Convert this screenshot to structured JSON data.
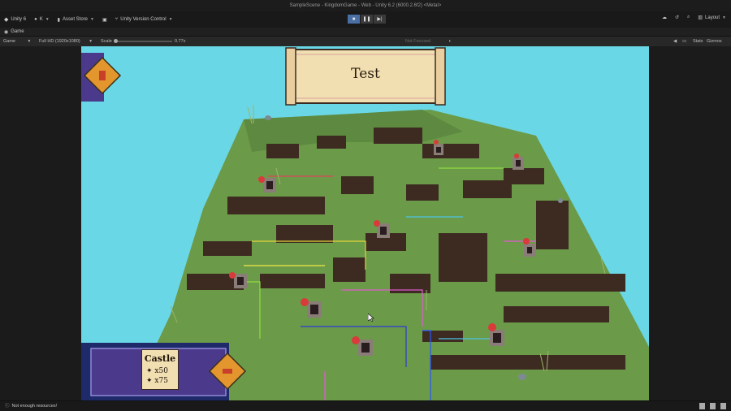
{
  "window": {
    "title": "SampleScene - KingdomGame - Web - Unity 6.2 (6000.2.6f2) <Metal>"
  },
  "toolbar": {
    "unity_label": "Unity 6",
    "account_label": "K",
    "asset_store_label": "Asset Store",
    "version_control_label": "Unity Version Control",
    "layout_label": "Layout"
  },
  "tab": {
    "game_label": "Game"
  },
  "game_bar": {
    "display_label": "Game",
    "resolution_label": "Full HD (1920x1080)",
    "scale_label": "Scale",
    "scale_value": "0.77x",
    "not_focused_label": "Not Focused",
    "stats_label": "Stats",
    "gizmos_label": "Gizmos"
  },
  "game": {
    "banner_text": "Test",
    "card": {
      "title": "Castle",
      "cost_1": "x50",
      "cost_2": "x75"
    }
  },
  "status": {
    "message": "Not enough resources!"
  },
  "colors": {
    "sky": "#6ad7e6",
    "grass": "#6b9a49",
    "wall": "#3d2b22",
    "ui_purple": "#4b3a8c",
    "ui_orange": "#e2962d",
    "play_active": "#4a6fa5"
  }
}
